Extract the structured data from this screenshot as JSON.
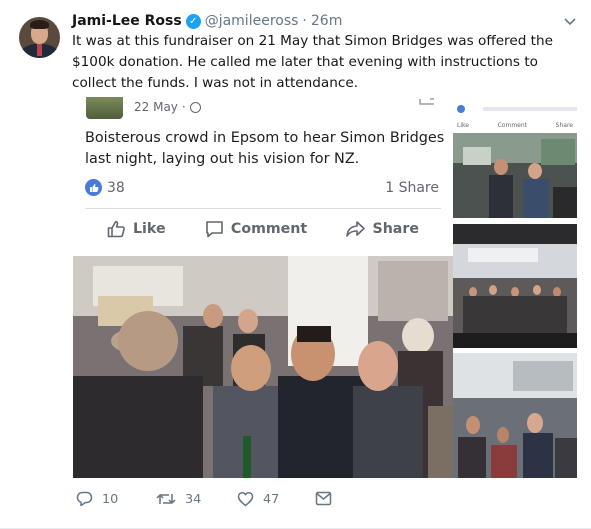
{
  "tweet": {
    "author_name": "Jami-Lee Ross",
    "handle": "@jamileeross",
    "separator": "·",
    "time": "26m",
    "text": "It was at this fundraiser on 21 May that Simon Bridges was offered the $100k donation. He called me later that evening with instructions to collect the funds. I was not in attendance.",
    "counts": {
      "replies": "10",
      "retweets": "34",
      "likes": "47"
    }
  },
  "embed": {
    "date": "22 May",
    "date_separator": "·",
    "text": "Boisterous crowd in Epsom to hear Simon Bridges last night, laying out his vision for NZ.",
    "reaction_count": "38",
    "share_count": "1 Share",
    "actions": {
      "like": "Like",
      "comment": "Comment",
      "share": "Share"
    },
    "mini_actions": {
      "like": "Like",
      "comment": "Comment",
      "share": "Share"
    }
  },
  "colors": {
    "twitter_blue": "#1da1f2",
    "facebook_blue": "#4a7bd6",
    "text_primary": "#14171a",
    "text_secondary": "#657786"
  }
}
